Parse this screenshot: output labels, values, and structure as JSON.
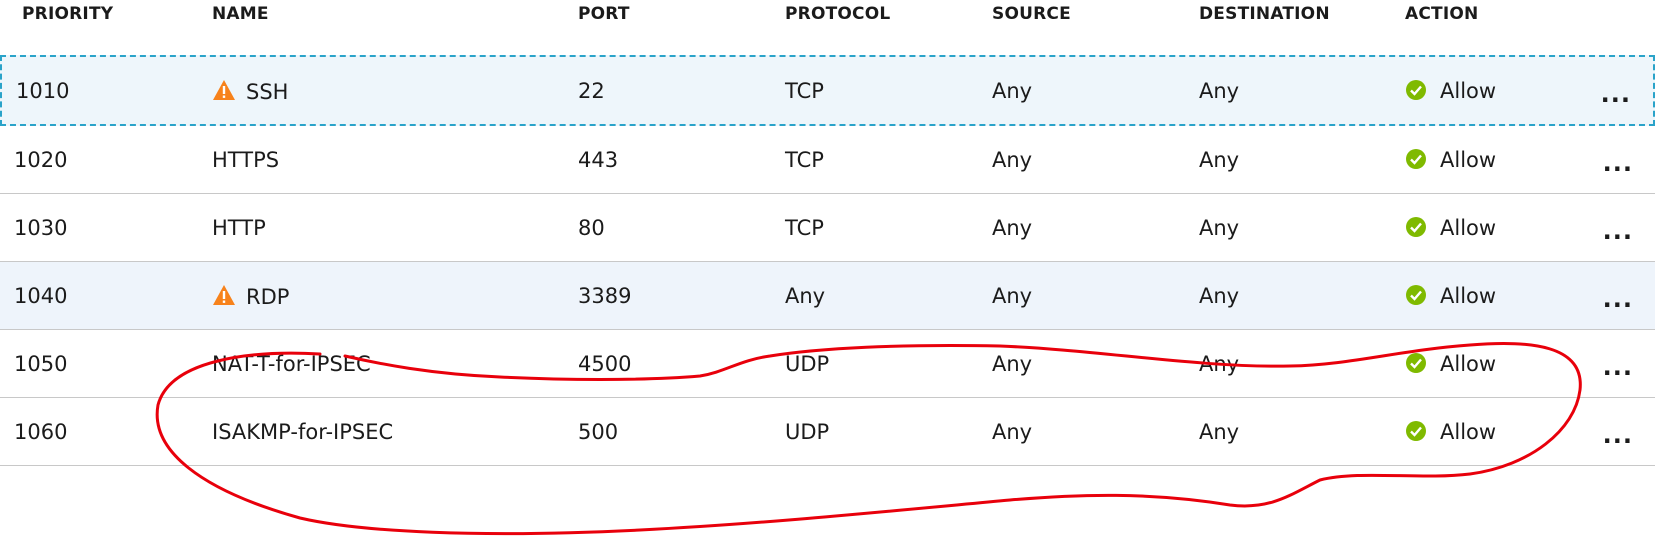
{
  "columns": {
    "priority": "PRIORITY",
    "name": "NAME",
    "port": "PORT",
    "protocol": "PROTOCOL",
    "source": "SOURCE",
    "destination": "DESTINATION",
    "action": "ACTION"
  },
  "rows": [
    {
      "priority": "1010",
      "name": "SSH",
      "port": "22",
      "protocol": "TCP",
      "source": "Any",
      "destination": "Any",
      "action": "Allow",
      "more": "...",
      "warning": true,
      "state": "selected"
    },
    {
      "priority": "1020",
      "name": "HTTPS",
      "port": "443",
      "protocol": "TCP",
      "source": "Any",
      "destination": "Any",
      "action": "Allow",
      "more": "...",
      "warning": false,
      "state": "normal"
    },
    {
      "priority": "1030",
      "name": "HTTP",
      "port": "80",
      "protocol": "TCP",
      "source": "Any",
      "destination": "Any",
      "action": "Allow",
      "more": "...",
      "warning": false,
      "state": "normal"
    },
    {
      "priority": "1040",
      "name": "RDP",
      "port": "3389",
      "protocol": "Any",
      "source": "Any",
      "destination": "Any",
      "action": "Allow",
      "more": "...",
      "warning": true,
      "state": "hover"
    },
    {
      "priority": "1050",
      "name": "NAT-T-for-IPSEC",
      "port": "4500",
      "protocol": "UDP",
      "source": "Any",
      "destination": "Any",
      "action": "Allow",
      "more": "...",
      "warning": false,
      "state": "normal"
    },
    {
      "priority": "1060",
      "name": "ISAKMP-for-IPSEC",
      "port": "500",
      "protocol": "UDP",
      "source": "Any",
      "destination": "Any",
      "action": "Allow",
      "more": "...",
      "warning": false,
      "state": "normal"
    }
  ],
  "icons": {
    "warning": "warning-icon",
    "allow": "check-circle-icon",
    "more": "more-options-icon"
  },
  "colors": {
    "warning": "#f7821b",
    "allow": "#7fba00",
    "selected_border": "#2aa3c9",
    "annotation": "#e8000b"
  }
}
